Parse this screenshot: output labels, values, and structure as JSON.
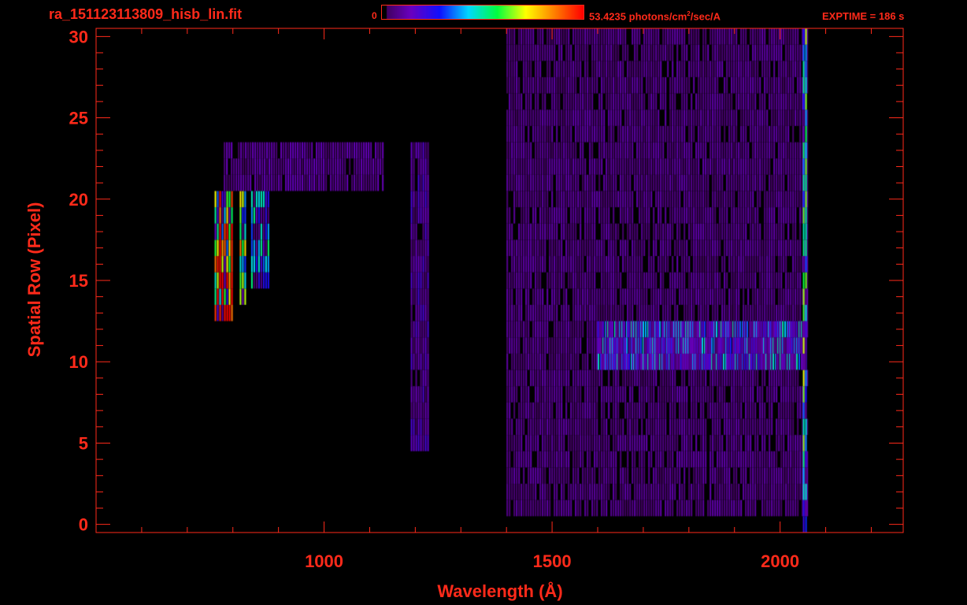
{
  "header": {
    "filename": "ra_151123113809_hisb_lin.fit",
    "colorbar_min": "0",
    "colorbar_max_value": "53.4235",
    "colorbar_unit_text": "photons/cm",
    "colorbar_unit_sup": "2",
    "colorbar_unit_tail": "/sec/A",
    "exptime": "EXPTIME = 186 s"
  },
  "colors": {
    "axis": "#ff2a1a",
    "background": "#000000",
    "colormap": [
      "#000000",
      "#3a0050",
      "#6a00c0",
      "#1010ff",
      "#00d8ff",
      "#00ff40",
      "#ffff00",
      "#ff8000",
      "#ff0000"
    ]
  },
  "chart_data": {
    "type": "heatmap",
    "title": "ra_151123113809_hisb_lin.fit",
    "xlabel": "Wavelength (Å)",
    "ylabel": "Spatial Row (Pixel)",
    "xlim": [
      500,
      2270
    ],
    "ylim": [
      -0.5,
      30.5
    ],
    "xticks": [
      1000,
      1500,
      2000
    ],
    "yticks": [
      0,
      5,
      10,
      15,
      20,
      25,
      30
    ],
    "colorbar_range": [
      0,
      53.4235
    ],
    "colorbar_unit": "photons/cm²/sec/A",
    "features": [
      {
        "name": "bright emission at 760-800 A",
        "x": [
          760,
          800
        ],
        "rows": [
          13,
          20
        ],
        "intensity": 50
      },
      {
        "name": "emission near 830 A",
        "x": [
          815,
          830
        ],
        "rows": [
          14,
          20
        ],
        "intensity": 35
      },
      {
        "name": "emission near 860-880 A",
        "x": [
          840,
          880
        ],
        "rows": [
          15,
          20
        ],
        "intensity": 22
      },
      {
        "name": "faint band rows 21-23",
        "x": [
          780,
          1130
        ],
        "rows": [
          21,
          23
        ],
        "intensity": 6
      },
      {
        "name": "emission near 1216 A",
        "x": [
          1190,
          1230
        ],
        "rows": [
          5,
          23
        ],
        "intensity": 8
      },
      {
        "name": "continuum rows 10-12",
        "x": [
          1600,
          2060
        ],
        "rows": [
          10,
          12
        ],
        "intensity": 20
      },
      {
        "name": "diffuse continuum",
        "x": [
          1400,
          2060
        ],
        "rows": [
          1,
          30
        ],
        "intensity": 5
      },
      {
        "name": "edge column near 2055 A",
        "x": [
          2050,
          2060
        ],
        "rows": [
          0,
          30
        ],
        "intensity": 28
      }
    ]
  }
}
